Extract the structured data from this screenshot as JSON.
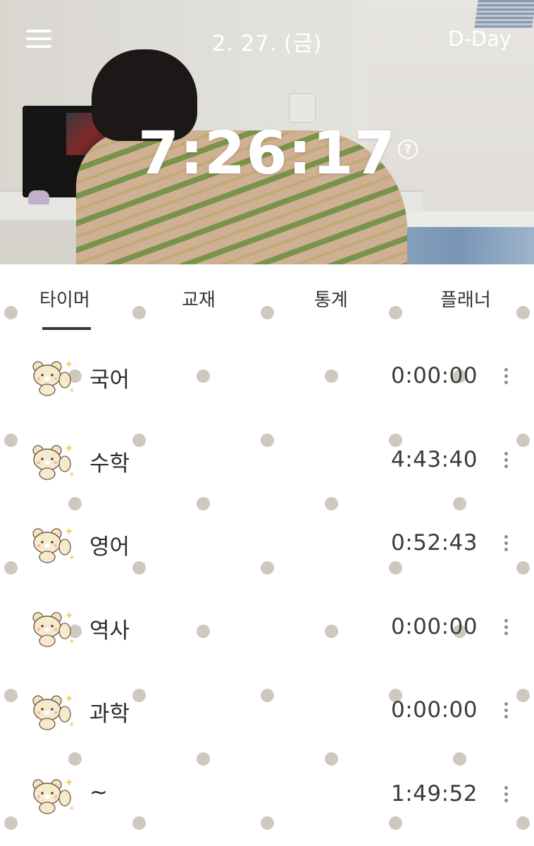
{
  "header": {
    "date": "2. 27. (금)",
    "dday_label": "D-Day",
    "total_time": "7:26:17",
    "help_glyph": "?"
  },
  "tabs": [
    {
      "label": "타이머",
      "active": true
    },
    {
      "label": "교재",
      "active": false
    },
    {
      "label": "통계",
      "active": false
    },
    {
      "label": "플래너",
      "active": false
    }
  ],
  "subjects": [
    {
      "name": "국어",
      "time": "0:00:00"
    },
    {
      "name": "수학",
      "time": "4:43:40"
    },
    {
      "name": "영어",
      "time": "0:52:43"
    },
    {
      "name": "역사",
      "time": "0:00:00"
    },
    {
      "name": "과학",
      "time": "0:00:00"
    },
    {
      "name": "~",
      "time": "1:49:52"
    }
  ],
  "icons": {
    "menu": "hamburger-menu-icon",
    "help": "question-circle-icon",
    "subject": "bear-sticker-icon",
    "more": "vertical-dots-icon"
  },
  "colors": {
    "dot": "#cfc8bf",
    "tab_underline": "#2f3a3e",
    "text": "#2f343a"
  }
}
